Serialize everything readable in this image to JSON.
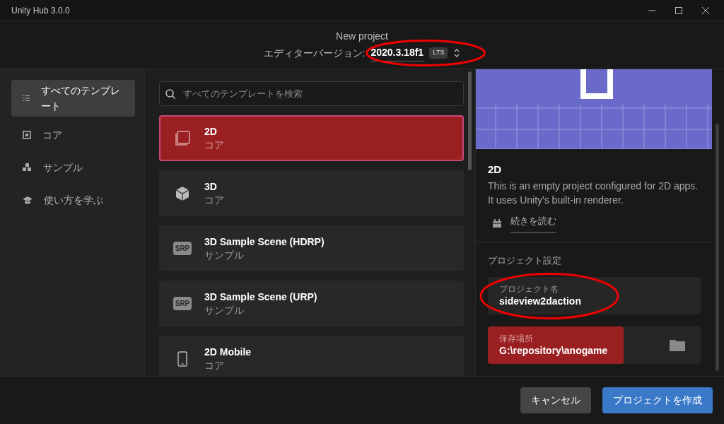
{
  "window": {
    "title": "Unity Hub 3.0.0"
  },
  "header": {
    "title": "New project",
    "version_label": "エディターバージョン:",
    "version": "2020.3.18f1",
    "version_badge": "LTS",
    "circled": true
  },
  "sidebar": {
    "items": [
      {
        "label": "すべてのテンプレート",
        "kind": "list",
        "selected": true
      },
      {
        "label": "コア",
        "kind": "core",
        "selected": false
      },
      {
        "label": "サンプル",
        "kind": "sample",
        "selected": false
      },
      {
        "label": "使い方を学ぶ",
        "kind": "learn",
        "selected": false
      }
    ]
  },
  "search": {
    "placeholder": "すべてのテンプレートを検索"
  },
  "templates": [
    {
      "name": "2D",
      "category": "コア",
      "kind": "square",
      "selected": true
    },
    {
      "name": "3D",
      "category": "コア",
      "kind": "cube",
      "selected": false
    },
    {
      "name": "3D Sample Scene (HDRP)",
      "category": "サンプル",
      "kind": "srp",
      "badge": "SRP",
      "selected": false
    },
    {
      "name": "3D Sample Scene (URP)",
      "category": "サンプル",
      "kind": "srp",
      "badge": "SRP",
      "selected": false
    },
    {
      "name": "2D Mobile",
      "category": "コア",
      "kind": "phone",
      "selected": false
    }
  ],
  "details": {
    "title": "2D",
    "description": "This is an empty project configured for 2D apps. It uses Unity's built-in renderer.",
    "read_more": "続きを読む"
  },
  "settings": {
    "heading": "プロジェクト設定",
    "fields": [
      {
        "label": "プロジェクト名",
        "value": "sideview2daction",
        "kind": "text",
        "circled": true,
        "highlighted": false
      },
      {
        "label": "保存場所",
        "value": "G:\\repository\\anogame",
        "kind": "folder",
        "circled": false,
        "highlighted": true
      }
    ]
  },
  "buttons": [
    {
      "label": "キャンセル",
      "kind": "secondary"
    },
    {
      "label": "プロジェクトを作成",
      "kind": "primary"
    }
  ]
}
